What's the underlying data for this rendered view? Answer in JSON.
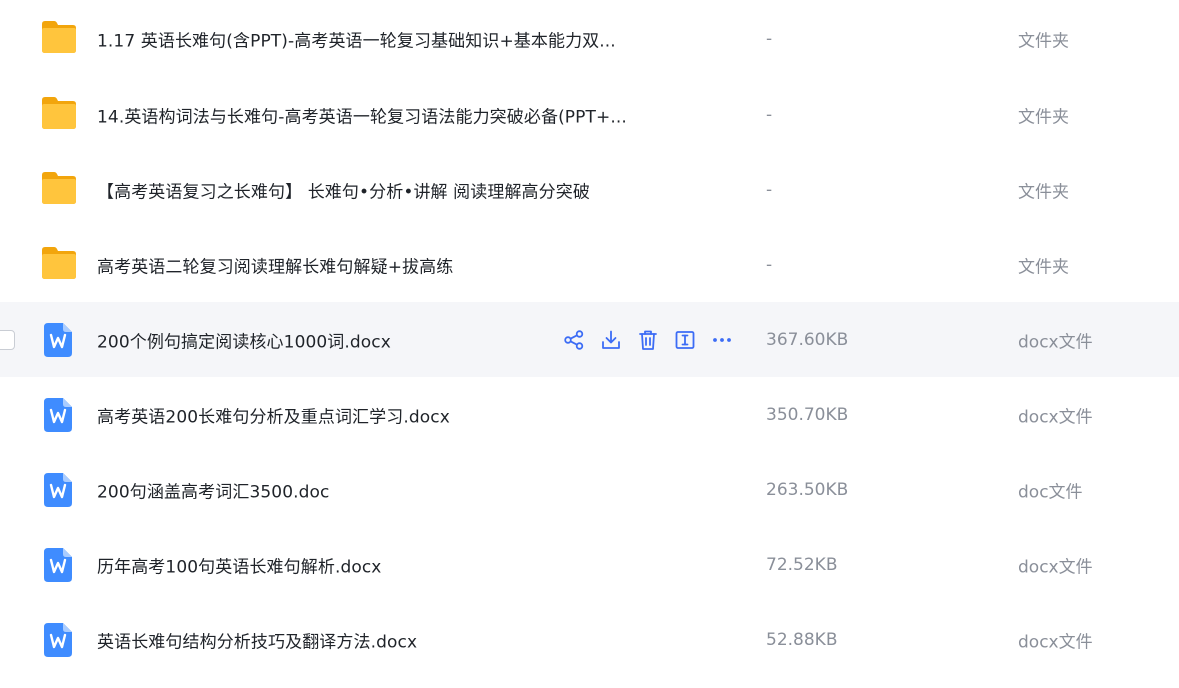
{
  "colors": {
    "accent": "#3c6cf5",
    "folder": "#ffc53d",
    "folder_dark": "#f2a50c",
    "doc_blue": "#3f8cff",
    "text": "#1f2329",
    "muted": "#8a8f99",
    "hover_bg": "#f5f6f9"
  },
  "files": [
    {
      "name": "1.17 英语长难句(含PPT)-高考英语一轮复习基础知识+基本能力双...",
      "size": "-",
      "type": "文件夹",
      "icon": "folder-icon"
    },
    {
      "name": "14.英语构词法与长难句-高考英语一轮复习语法能力突破必备(PPT+...",
      "size": "-",
      "type": "文件夹",
      "icon": "folder-icon"
    },
    {
      "name": "【高考英语复习之长难句】 长难句•分析•讲解 阅读理解高分突破",
      "size": "-",
      "type": "文件夹",
      "icon": "folder-icon"
    },
    {
      "name": "高考英语二轮复习阅读理解长难句解疑+拔高练",
      "size": "-",
      "type": "文件夹",
      "icon": "folder-icon"
    },
    {
      "name": "200个例句搞定阅读核心1000词.docx",
      "size": "367.60KB",
      "type": "docx文件",
      "icon": "word-doc-icon"
    },
    {
      "name": "高考英语200长难句分析及重点词汇学习.docx",
      "size": "350.70KB",
      "type": "docx文件",
      "icon": "word-doc-icon"
    },
    {
      "name": "200句涵盖高考词汇3500.doc",
      "size": "263.50KB",
      "type": "doc文件",
      "icon": "word-doc-icon"
    },
    {
      "name": "历年高考100句英语长难句解析.docx",
      "size": "72.52KB",
      "type": "docx文件",
      "icon": "word-doc-icon"
    },
    {
      "name": "英语长难句结构分析技巧及翻译方法.docx",
      "size": "52.88KB",
      "type": "docx文件",
      "icon": "word-doc-icon"
    }
  ],
  "row_actions": [
    "share-icon",
    "download-icon",
    "delete-icon",
    "rename-icon",
    "more-icon"
  ]
}
